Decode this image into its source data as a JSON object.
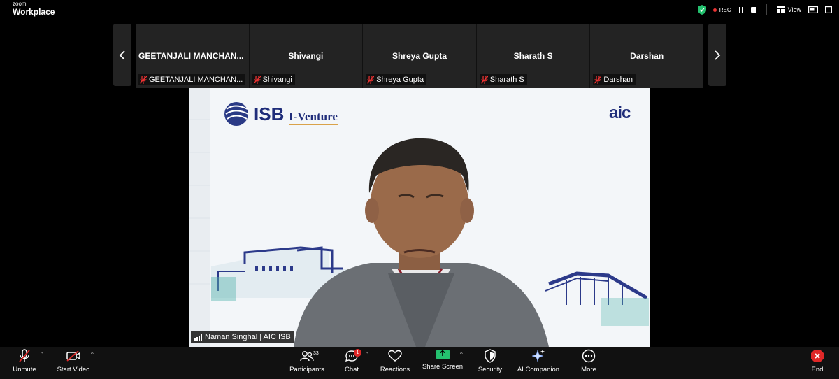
{
  "app": {
    "brand_small": "zoom",
    "brand_big": "Workplace"
  },
  "topbar": {
    "rec_label": "REC",
    "view_label": "View"
  },
  "gallery": {
    "tiles": [
      {
        "name": "GEETANJALI MANCHAN...",
        "tag": "GEETANJALI MANCHAN..."
      },
      {
        "name": "Shivangi",
        "tag": "Shivangi"
      },
      {
        "name": "Shreya Gupta",
        "tag": "Shreya Gupta"
      },
      {
        "name": "Sharath S",
        "tag": "Sharath S"
      },
      {
        "name": "Darshan",
        "tag": "Darshan"
      }
    ]
  },
  "main_video": {
    "slide_logo": "ISB",
    "slide_subtitle": "I-Venture",
    "corner_logo": "aic",
    "speaker": "Naman Singhal | AIC ISB"
  },
  "toolbar": {
    "unmute": "Unmute",
    "start_video": "Start Video",
    "participants": "Participants",
    "participants_count": "33",
    "chat": "Chat",
    "chat_badge": "1",
    "reactions": "Reactions",
    "share_screen": "Share Screen",
    "security": "Security",
    "ai_companion": "AI Companion",
    "more": "More",
    "end": "End"
  },
  "colors": {
    "accent_green": "#24c16f",
    "end_red": "#e02828",
    "rec_red": "#e33333"
  }
}
